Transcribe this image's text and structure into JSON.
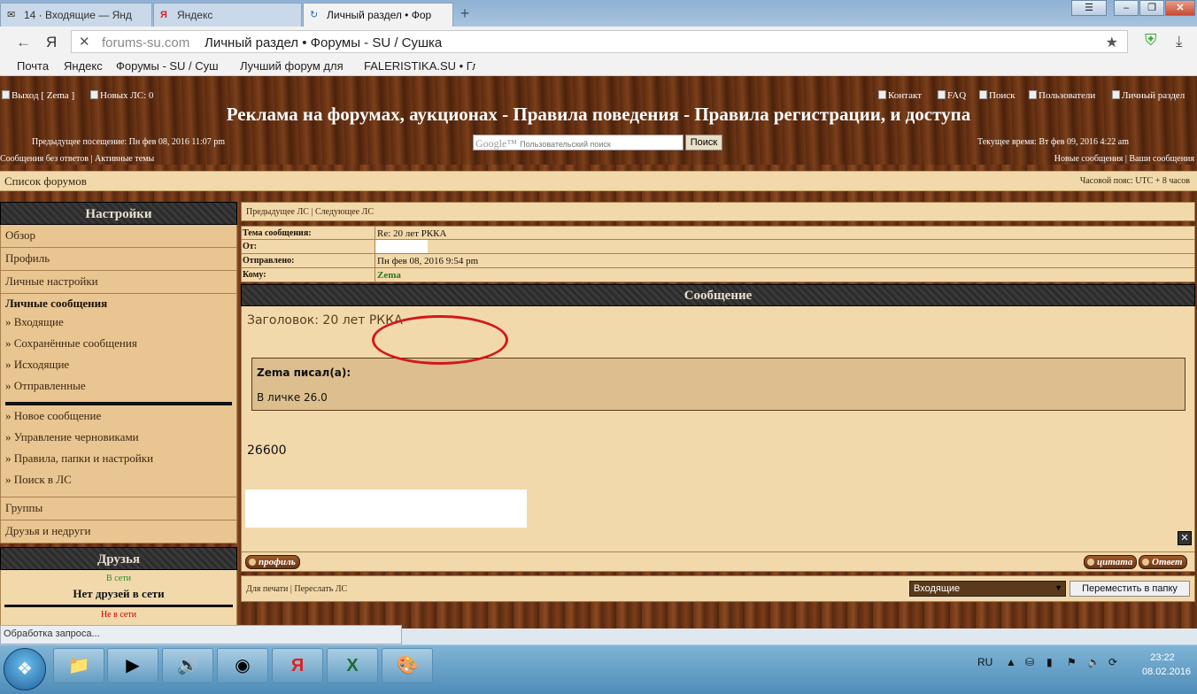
{
  "browser": {
    "tabs": [
      {
        "label": "14 · Входящие — Янд",
        "icon": "mail-icon"
      },
      {
        "label": "Яндекс",
        "icon": "yandex-icon"
      },
      {
        "label": "Личный раздел • Фор",
        "icon": "loading-icon"
      }
    ],
    "address": {
      "domain": "forums-su.com",
      "title": "Личный раздел • Форумы - SU / Сушка"
    },
    "bookmarks": [
      "Почта",
      "Яндекс",
      "Форумы - SU / Суш",
      "Лучший форум для",
      "FALERISTIKA.SU • Гл"
    ],
    "status_text": "Обработка запроса...",
    "yandex_logo": "Я"
  },
  "header": {
    "logout": "Выход [ Zema ]",
    "new_pm": "Новых ЛС: 0",
    "links": [
      "Контакт",
      "FAQ",
      "Поиск",
      "Пользователи",
      "Личный раздел"
    ],
    "title": "Реклама на форумах, аукционах - Правила поведения - Правила регистрации, и доступа",
    "prev_visit": "Предыдущее посещение: Пн фев 08, 2016 11:07 pm",
    "current_time": "Текущее время: Вт фев 09, 2016 4:22 am",
    "search_google": "Google™",
    "search_placeholder": "Пользовательский поиск",
    "search_button": "Поиск",
    "left_links": "Сообщения без ответов  |  Активные темы",
    "right_links": "Новые сообщения  |  Ваши сообщения"
  },
  "forumlist": {
    "label": "Список форумов",
    "timezone": "Часовой пояс: UTC + 8 часов"
  },
  "sidebar": {
    "settings_title": "Настройки",
    "top_items": [
      "Обзор",
      "Профиль",
      "Личные настройки"
    ],
    "pm_title": "Личные сообщения",
    "pm_items": [
      "» Входящие",
      "» Сохранённые сообщения",
      "» Исходящие",
      "» Отправленные"
    ],
    "pm_items2": [
      "» Новое сообщение",
      "» Управление черновиками",
      "» Правила, папки и настройки",
      "» Поиск в ЛС"
    ],
    "bottom_items": [
      "Группы",
      "Друзья и недруги"
    ],
    "friends_title": "Друзья",
    "online_label": "В сети",
    "no_friends": "Нет друзей в сети",
    "offline_label": "Не в сети"
  },
  "message": {
    "nav": "Предыдущее ЛС  |  Следующее ЛС",
    "fields": [
      {
        "key": "Тема сообщения:",
        "value": "Re: 20 лет РККА"
      },
      {
        "key": "От:",
        "value": ""
      },
      {
        "key": "Отправлено:",
        "value": "Пн фев 08, 2016 9:54 pm"
      },
      {
        "key": "Кому:",
        "value": "Zema"
      }
    ],
    "section_title": "Сообщение",
    "subject_line": "Заголовок: 20 лет РККА",
    "quote_author": "Zema писал(а):",
    "quote_text": "В личке 26.0",
    "body": "26600",
    "profile_button": "профиль",
    "quote_button": "цитата",
    "reply_button": "Ответ",
    "footer_links": "Для печати  |  Переслать ЛС",
    "folder_select": "Входящие",
    "move_button": "Переместить в папку"
  },
  "taskbar": {
    "lang": "RU",
    "time": "23:22",
    "date": "08.02.2016",
    "icon_names": [
      "explorer-icon",
      "media-player-icon",
      "sound-icon",
      "chrome-icon",
      "yandex-browser-icon",
      "excel-icon",
      "paint-icon"
    ]
  }
}
